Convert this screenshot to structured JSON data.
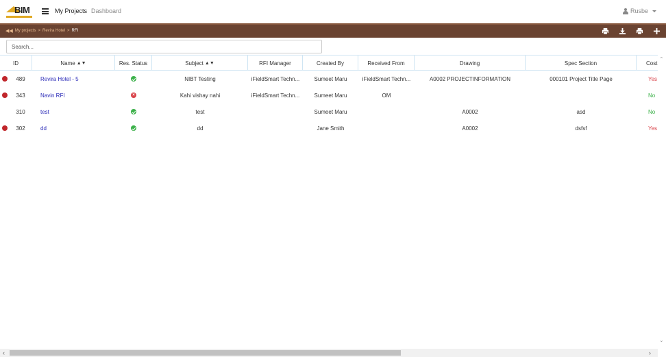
{
  "nav": {
    "logo_text": "BIM",
    "my_projects": "My Projects",
    "dashboard": "Dashboard",
    "user": "Rusbe"
  },
  "breadcrumb": {
    "items": [
      "My projects",
      "Revira Hotel",
      "RFI"
    ]
  },
  "toolbar": {
    "icons": [
      "print-icon",
      "download-icon",
      "print-icon",
      "plus-icon"
    ]
  },
  "search": {
    "placeholder": "Search..."
  },
  "table": {
    "columns": [
      "ID",
      "Name",
      "Res. Status",
      "Subject",
      "RFI Manager",
      "Created By",
      "Received From",
      "Drawing",
      "Spec Section",
      "Cost Impact"
    ],
    "rows": [
      {
        "flag": true,
        "id": "489",
        "name": "Revira Hotel - 5",
        "status": "ok",
        "subject": "NIBT Testing",
        "manager": "iFieldSmart Techn...",
        "created_by": "Sumeet Maru",
        "received_from": "iFieldSmart Techn...",
        "drawing": "A0002 PROJECTINFORMATION",
        "spec": "000101 Project Title Page",
        "cost": "Yes"
      },
      {
        "flag": true,
        "id": "343",
        "name": "Navin RFI",
        "status": "err",
        "subject": "Kahi vishay nahi",
        "manager": "iFieldSmart Techn...",
        "created_by": "Sumeet Maru",
        "received_from": "OM",
        "drawing": "",
        "spec": "",
        "cost": "No"
      },
      {
        "flag": false,
        "id": "310",
        "name": "test",
        "status": "ok",
        "subject": "test",
        "manager": "",
        "created_by": "Sumeet Maru",
        "received_from": "",
        "drawing": "A0002",
        "spec": "asd",
        "cost": "No"
      },
      {
        "flag": true,
        "id": "302",
        "name": "dd",
        "status": "ok",
        "subject": "dd",
        "manager": "",
        "created_by": "Jane Smith",
        "received_from": "",
        "drawing": "A0002",
        "spec": "dsfsf",
        "cost": "Yes"
      }
    ]
  },
  "colors": {
    "brown_bar": "#6a4331",
    "accent_logo": "#e0a823",
    "flag_red": "#c0262b",
    "status_green": "#3cb14a",
    "link_blue": "#2b2bb8"
  }
}
